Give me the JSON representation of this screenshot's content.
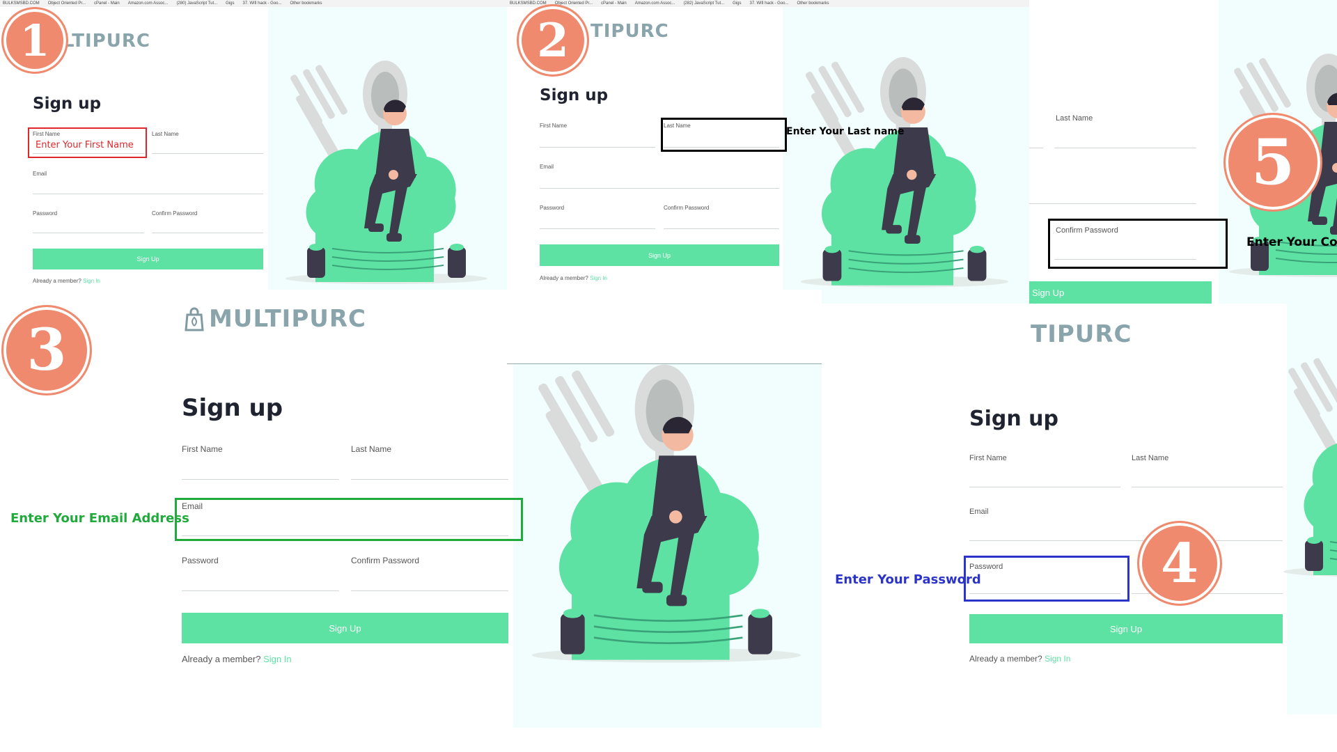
{
  "brand": {
    "full": "MULTIPURC",
    "partial_1": "LTIPURC",
    "partial_2": "TIPURC",
    "partial_4": "TIPURC"
  },
  "form": {
    "title": "Sign up",
    "first_name": "First Name",
    "last_name": "Last Name",
    "email": "Email",
    "password": "Password",
    "confirm_password": "Confirm Password",
    "submit": "Sign Up",
    "already": "Already a member?",
    "sign_in": "Sign In"
  },
  "steps": {
    "s1": {
      "badge": "1",
      "hint": "Enter Your First Name",
      "color": "#e0262a"
    },
    "s2": {
      "badge": "2",
      "hint": "Enter Your Last name",
      "color": "#000000"
    },
    "s3": {
      "badge": "3",
      "hint": "Enter Your Email Address",
      "color": "#1faa3b"
    },
    "s4": {
      "badge": "4",
      "hint": "Enter Your Password",
      "color": "#2b33c9"
    },
    "s5": {
      "badge": "5",
      "hint": "Enter Your Cor",
      "color": "#000000"
    }
  },
  "bookmarks_1": [
    "BULKSMSBD.COM",
    "Object Oriented Pr...",
    "cPanel - Main",
    "Amazon.com Assoc...",
    "(280) JavaScript Tut...",
    "Gigs",
    "37. Wifi hack - Goo...",
    "Other bookmarks"
  ],
  "bookmarks_2": [
    "BULKSMSBD.COM",
    "Object Oriented Pr...",
    "cPanel - Main",
    "Amazon.com Assoc...",
    "(282) JavaScript Tut...",
    "Gigs",
    "37. Wifi hack - Goo...",
    "Other bookmarks"
  ],
  "colors": {
    "accent": "#5de2a4",
    "badge": "#ef8a6e",
    "illus_bg": "#f1fefd",
    "dark": "#3d3a4b"
  }
}
